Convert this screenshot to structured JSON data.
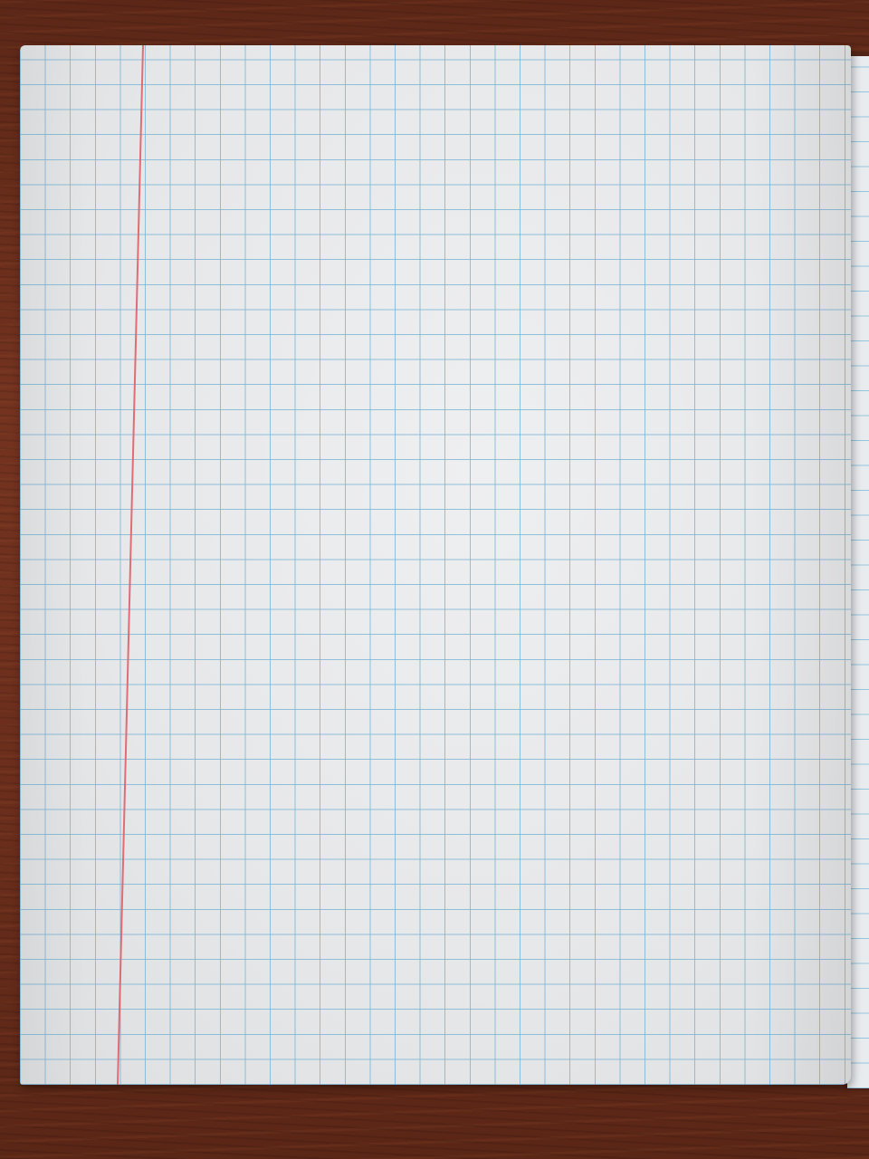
{
  "scene": {
    "description_free": true,
    "surface": "wooden-table",
    "paper": "graph-paper-notebook-sheet"
  },
  "colors": {
    "table": "#6a2f1c",
    "paper": "#e8e9ea",
    "grid_line": "#78b4d4",
    "margin_line": "#e0606a"
  },
  "sheet": {
    "grid": "square",
    "margin_side": "left",
    "writing": ""
  }
}
